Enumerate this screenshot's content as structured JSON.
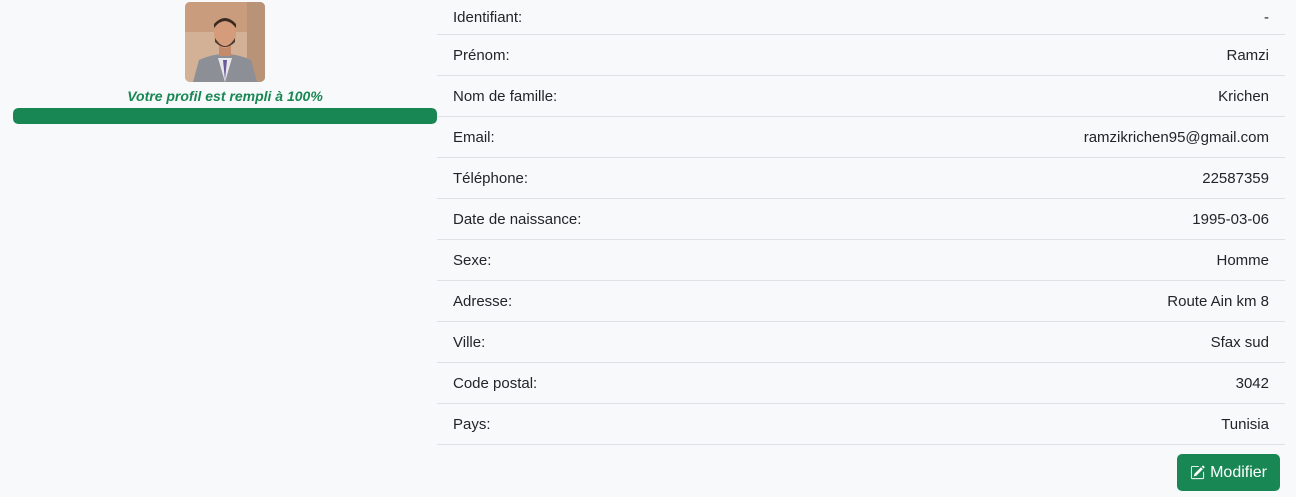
{
  "profile": {
    "completion_text": "Votre profil est rempli à 100%",
    "completion_percent": 100,
    "accent_color": "#198754"
  },
  "details": [
    {
      "label": "Identifiant:",
      "value": "-"
    },
    {
      "label": "Prénom:",
      "value": "Ramzi"
    },
    {
      "label": "Nom de famille:",
      "value": "Krichen"
    },
    {
      "label": "Email:",
      "value": "ramzikrichen95@gmail.com"
    },
    {
      "label": "Téléphone:",
      "value": "22587359"
    },
    {
      "label": "Date de naissance:",
      "value": "1995-03-06"
    },
    {
      "label": "Sexe:",
      "value": "Homme"
    },
    {
      "label": "Adresse:",
      "value": "Route Ain km 8"
    },
    {
      "label": "Ville:",
      "value": "Sfax sud"
    },
    {
      "label": "Code postal:",
      "value": "3042"
    },
    {
      "label": "Pays:",
      "value": "Tunisia"
    }
  ],
  "actions": {
    "edit_label": "Modifier",
    "edit_icon": "pencil-square-icon"
  }
}
